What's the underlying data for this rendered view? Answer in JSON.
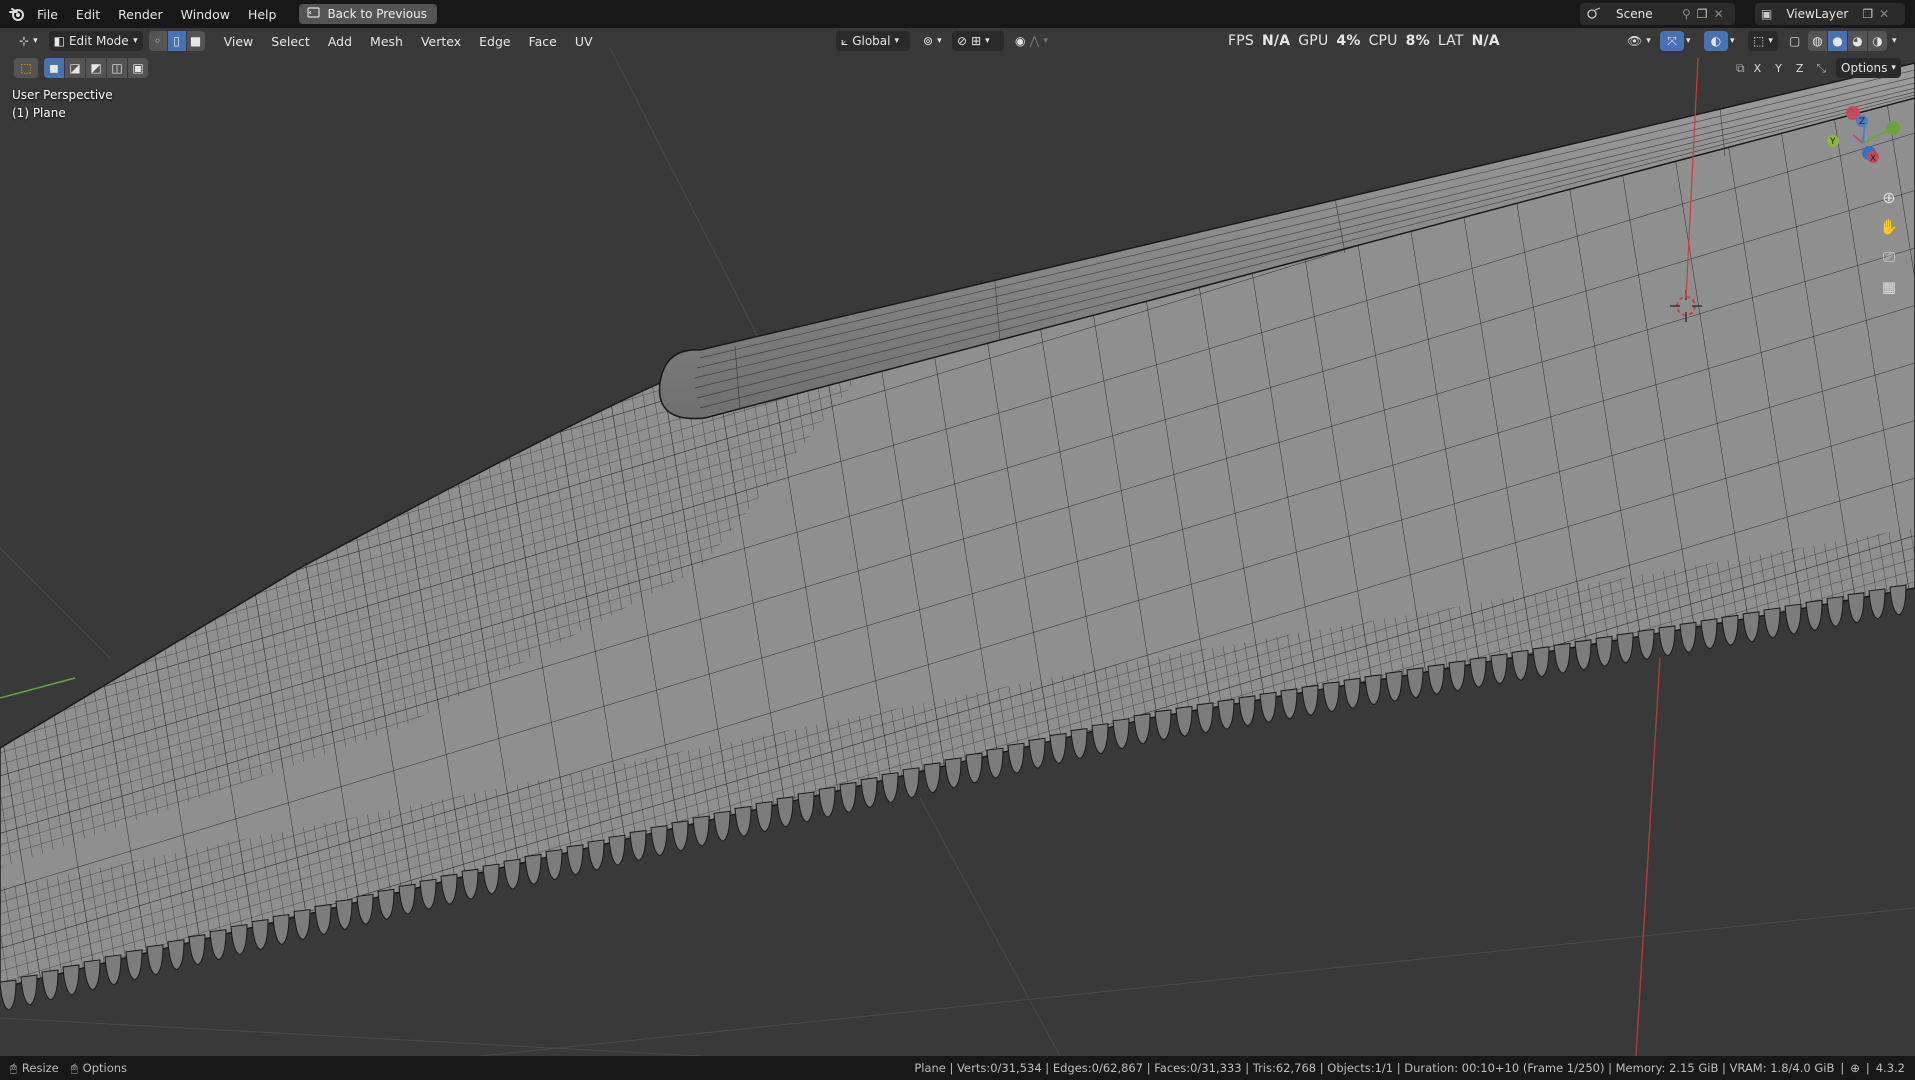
{
  "menubar": {
    "items": [
      "File",
      "Edit",
      "Render",
      "Window",
      "Help"
    ],
    "back_button": "Back to Previous",
    "scene_name": "Scene",
    "view_layer": "ViewLayer"
  },
  "viewport_header": {
    "mode": "Edit Mode",
    "menus": [
      "View",
      "Select",
      "Add",
      "Mesh",
      "Vertex",
      "Edge",
      "Face",
      "UV"
    ],
    "orientation": "Global",
    "options_label": "Options",
    "axis_toggles": [
      "X",
      "Y",
      "Z"
    ]
  },
  "perf_stats": {
    "fps_label": "FPS",
    "fps_value": "N/A",
    "gpu_label": "GPU",
    "gpu_value": "4%",
    "cpu_label": "CPU",
    "cpu_value": "8%",
    "lat_label": "LAT",
    "lat_value": "N/A"
  },
  "viewport_info": {
    "view_name": "User Perspective",
    "object_name": "(1) Plane"
  },
  "gizmo": {
    "x": "X",
    "y": "Y",
    "z": "Z"
  },
  "statusbar": {
    "left_action_1": "Resize",
    "left_action_2": "Options",
    "stats": "Plane | Verts:0/31,534 | Edges:0/62,867 | Faces:0/31,333 | Tris:62,768 | Objects:1/1 | Duration: 00:10+10 (Frame 1/250) | Memory: 2.15 GiB | VRAM: 1.8/4.0 GiB",
    "version": "4.3.2"
  },
  "colors": {
    "mesh_fill": "#8a8a8a",
    "wire": "#1a1a1a",
    "viewport_bg": "#393939",
    "accent": "#4772b3"
  }
}
